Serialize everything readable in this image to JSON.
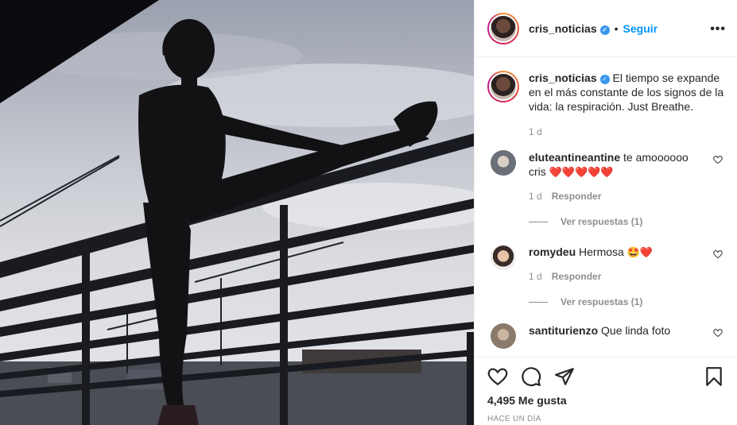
{
  "post": {
    "username": "cris_noticias",
    "follow_label": "Seguir",
    "dot": "•",
    "more": "•••",
    "caption": "El tiempo se expande en el más constante de los signos de la vida: la respiración. Just Breathe.",
    "caption_age": "1 d"
  },
  "comments": [
    {
      "username": "eluteantineantine",
      "text": "te amoooooo cris",
      "emojis": "❤️❤️❤️❤️❤️",
      "age": "1 d",
      "reply_label": "Responder",
      "view_replies": "Ver respuestas (1)"
    },
    {
      "username": "romydeu",
      "text": "Hermosa",
      "emojis": "🤩❤️",
      "age": "1 d",
      "reply_label": "Responder",
      "view_replies": "Ver respuestas (1)"
    },
    {
      "username": "santiturienzo",
      "text": "Que linda foto"
    }
  ],
  "footer": {
    "likes": "4,495 Me gusta",
    "timestamp": "HACE UN DÍA"
  },
  "colors": {
    "accent": "#0095f6",
    "verified": "#3897f0",
    "muted": "#8e8e8e"
  }
}
